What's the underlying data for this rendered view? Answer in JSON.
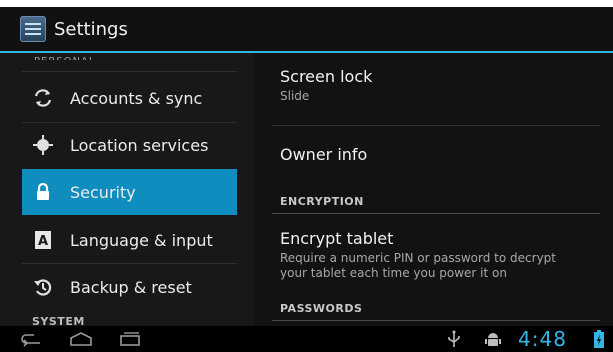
{
  "action_bar": {
    "title": "Settings",
    "icon": "settings-app-icon"
  },
  "sidebar": {
    "section_peek": "PERSONAL",
    "items": [
      {
        "label": "Accounts & sync",
        "icon": "sync-icon",
        "selected": false
      },
      {
        "label": "Location services",
        "icon": "location-icon",
        "selected": false
      },
      {
        "label": "Security",
        "icon": "lock-icon",
        "selected": true
      },
      {
        "label": "Language & input",
        "icon": "keyboard-a-icon",
        "selected": false
      },
      {
        "label": "Backup & reset",
        "icon": "backup-icon",
        "selected": false
      }
    ],
    "system_header": "SYSTEM"
  },
  "security": {
    "screen_lock": {
      "title": "Screen lock",
      "summary": "Slide"
    },
    "owner_info": {
      "title": "Owner info"
    },
    "encryption_header": "ENCRYPTION",
    "encrypt_tablet": {
      "title": "Encrypt tablet",
      "summary_line1": "Require a numeric PIN or password to decrypt",
      "summary_line2": "your tablet each time you power it on"
    },
    "passwords_header": "PASSWORDS"
  },
  "status_bar": {
    "time": "4:48",
    "icons": [
      "back-icon",
      "home-icon",
      "recent-apps-icon",
      "usb-icon",
      "android-debug-icon",
      "battery-icon"
    ]
  },
  "colors": {
    "accent": "#33b5e5",
    "selected": "#0f8dbf"
  }
}
